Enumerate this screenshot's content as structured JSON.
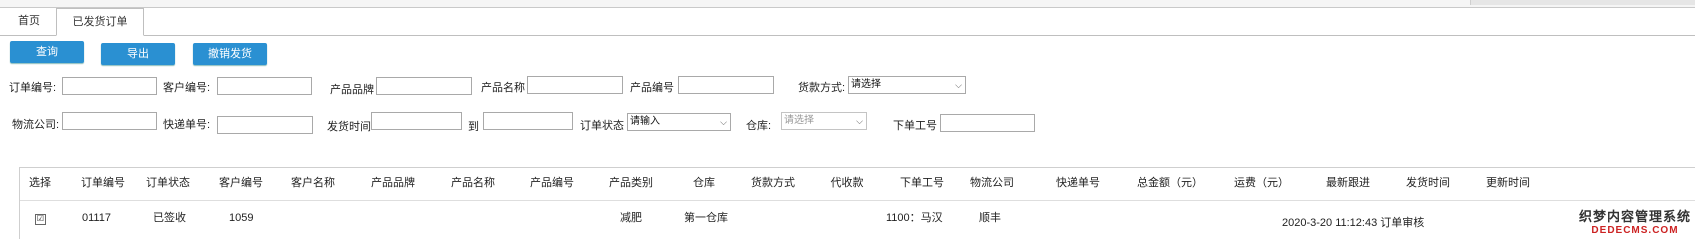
{
  "tabs": [
    {
      "label": "首页"
    },
    {
      "label": "已发货订单"
    }
  ],
  "toolbar": {
    "query_label": "查询",
    "export_label": "导出",
    "cancel_ship_label": "撤销发货"
  },
  "filters": {
    "order_no_label": "订单编号:",
    "order_no_value": "",
    "customer_no_label": "客户编号:",
    "customer_no_value": "",
    "brand_label": "产品品牌",
    "brand_value": "",
    "product_name_label": "产品名称",
    "product_name_value": "",
    "product_no_label": "产品编号",
    "product_no_value": "",
    "payment_label": "货款方式:",
    "payment_value": "请选择",
    "logistics_label": "物流公司:",
    "logistics_value": "",
    "tracking_label": "快递单号:",
    "tracking_value": "",
    "ship_time_label": "发货时间:",
    "ship_time_from": "",
    "to_label": "到",
    "ship_time_to": "",
    "status_label": "订单状态",
    "status_value": "请输入",
    "warehouse_label": "仓库:",
    "warehouse_value": "请选择",
    "staff_label": "下单工号",
    "staff_value": ""
  },
  "table": {
    "headers": [
      "选择",
      "订单编号",
      "订单状态",
      "客户编号",
      "客户名称",
      "产品品牌",
      "产品名称",
      "产品编号",
      "产品类别",
      "仓库",
      "货款方式",
      "代收款",
      "下单工号",
      "物流公司",
      "快递单号",
      "总金额（元）",
      "运费（元）",
      "最新跟进",
      "发货时间",
      "更新时间"
    ],
    "rows": [
      {
        "checked": "☑",
        "order_no": "01117",
        "status": "已签收",
        "customer_no": "1059",
        "category": "减肥",
        "warehouse": "第一仓库",
        "staff": "1100：马汉",
        "logistics": "顺丰",
        "follow_up": "2020-3-20 11:12:43 订单审核"
      }
    ]
  },
  "watermark": {
    "cn": "织梦内容管理系统",
    "en": "DEDECMS.COM"
  }
}
